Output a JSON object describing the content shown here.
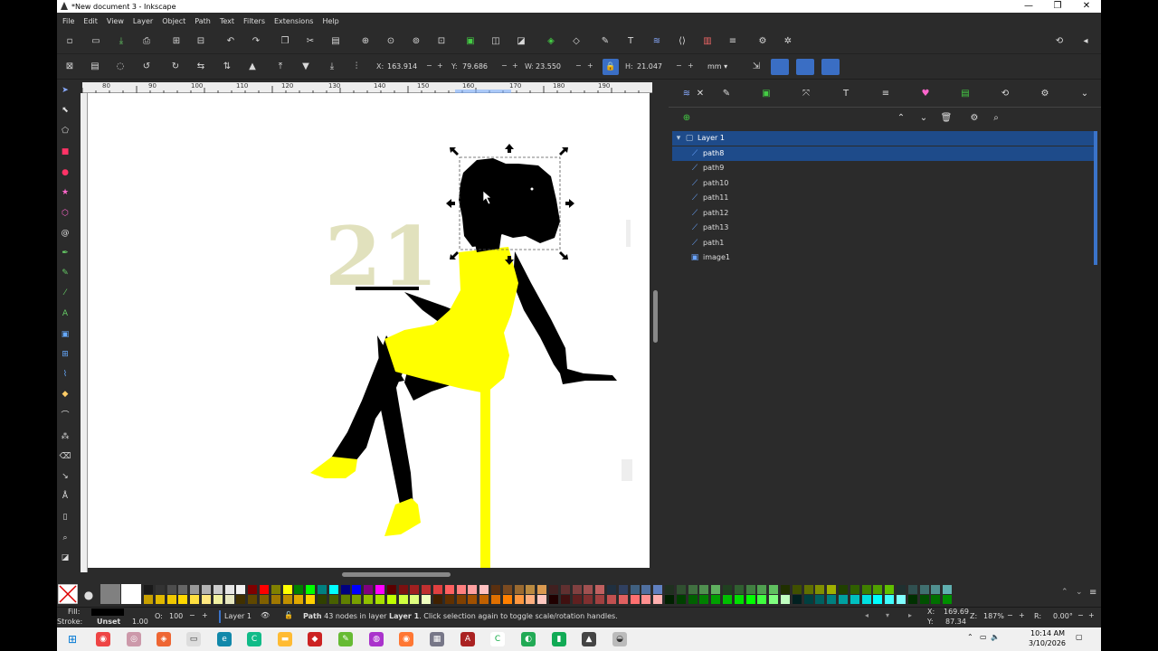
{
  "window": {
    "title": "*New document 3 - Inkscape",
    "controls": [
      "—",
      "❐",
      "✕"
    ]
  },
  "menu": [
    "File",
    "Edit",
    "View",
    "Layer",
    "Object",
    "Path",
    "Text",
    "Filters",
    "Extensions",
    "Help"
  ],
  "controls": {
    "x_label": "X:",
    "x_value": "163.914",
    "y_label": "Y:",
    "y_value": "79.686",
    "w_label": "W:",
    "w_value": "23.550",
    "h_label": "H:",
    "h_value": "21.047",
    "unit": "mm",
    "minus": "−",
    "plus": "+"
  },
  "ruler": {
    "ticks": [
      "80",
      "90",
      "100",
      "110",
      "120",
      "130",
      "140",
      "150",
      "160",
      "170",
      "180",
      "190"
    ]
  },
  "canvas": {
    "cake_topper_text": "21"
  },
  "objects_panel": {
    "layer": "Layer 1",
    "items": [
      {
        "name": "path8",
        "selected": true
      },
      {
        "name": "path9"
      },
      {
        "name": "path10"
      },
      {
        "name": "path11"
      },
      {
        "name": "path12"
      },
      {
        "name": "path13"
      },
      {
        "name": "path1"
      },
      {
        "name": "image1"
      }
    ]
  },
  "style": {
    "fill_label": "Fill:",
    "stroke_label": "Stroke:",
    "stroke_value": "Unset",
    "stroke_width": "1.00",
    "opacity_label": "O:",
    "opacity_value": "100"
  },
  "status": {
    "layer": "Layer 1",
    "message_bold": "Path",
    "message_mid": " 43 nodes in layer ",
    "message_layer": "Layer 1",
    "message_tail": ". Click selection again to toggle scale/rotation handles.",
    "cursor_x_label": "X:",
    "cursor_x": "169.69",
    "cursor_y_label": "Y:",
    "cursor_y": "87.34",
    "zoom_label": "Z:",
    "zoom": "187%",
    "rotation_label": "R:",
    "rotation": "0.00°"
  },
  "taskbar": {
    "time": "10:14 AM",
    "date": "3/10/2026"
  },
  "colors": {
    "accent": "#1e4b8a",
    "yellow": "#ffff00",
    "silhouette": "#000000",
    "canvas": "#ffffff",
    "chrome": "#2b2b2b"
  }
}
